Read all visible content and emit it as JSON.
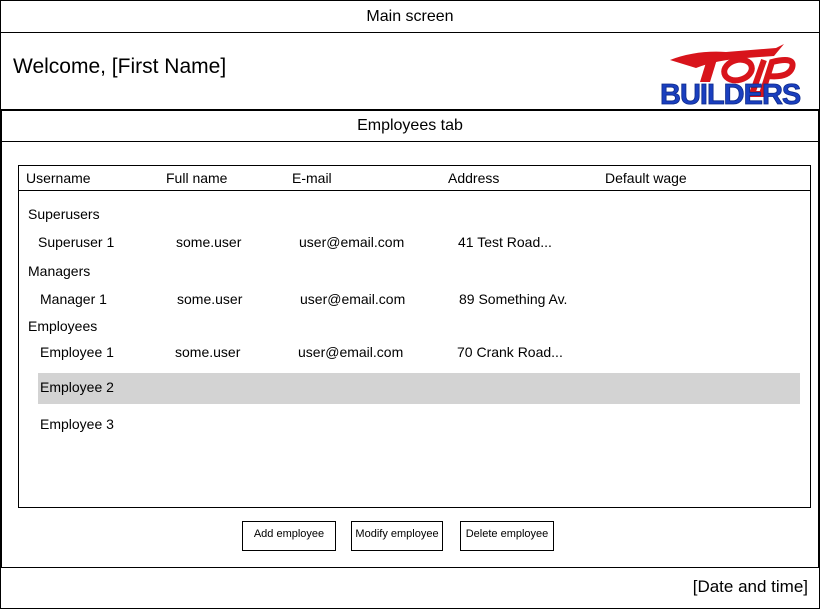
{
  "window": {
    "title": "Main screen"
  },
  "header": {
    "welcome": "Welcome, [First Name]",
    "logo_text_top": "Top",
    "logo_text_bottom": "BUILDERS"
  },
  "tab": {
    "title": "Employees tab"
  },
  "table": {
    "columns": [
      "Username",
      "Full name",
      "E-mail",
      "Address",
      "Default wage"
    ],
    "groups": [
      {
        "label": "Superusers",
        "rows": [
          {
            "username": "Superuser 1",
            "fullname": "some.user",
            "email": "user@email.com",
            "address": "41 Test Road..."
          }
        ]
      },
      {
        "label": "Managers",
        "rows": [
          {
            "username": "Manager 1",
            "fullname": "some.user",
            "email": "user@email.com",
            "address": "89 Something Av."
          }
        ]
      },
      {
        "label": "Employees",
        "rows": [
          {
            "username": "Employee 1",
            "fullname": "some.user",
            "email": "user@email.com",
            "address": "70 Crank Road..."
          },
          {
            "username": "Employee 2"
          },
          {
            "username": "Employee 3"
          }
        ]
      }
    ]
  },
  "buttons": {
    "add": "Add employee",
    "modify": "Modify employee",
    "delete": "Delete employee"
  },
  "footer": {
    "datetime": "[Date and time]"
  },
  "colors": {
    "selected_row": "#d3d3d3",
    "logo_red": "#d8141b",
    "logo_blue": "#1a3fbf"
  }
}
